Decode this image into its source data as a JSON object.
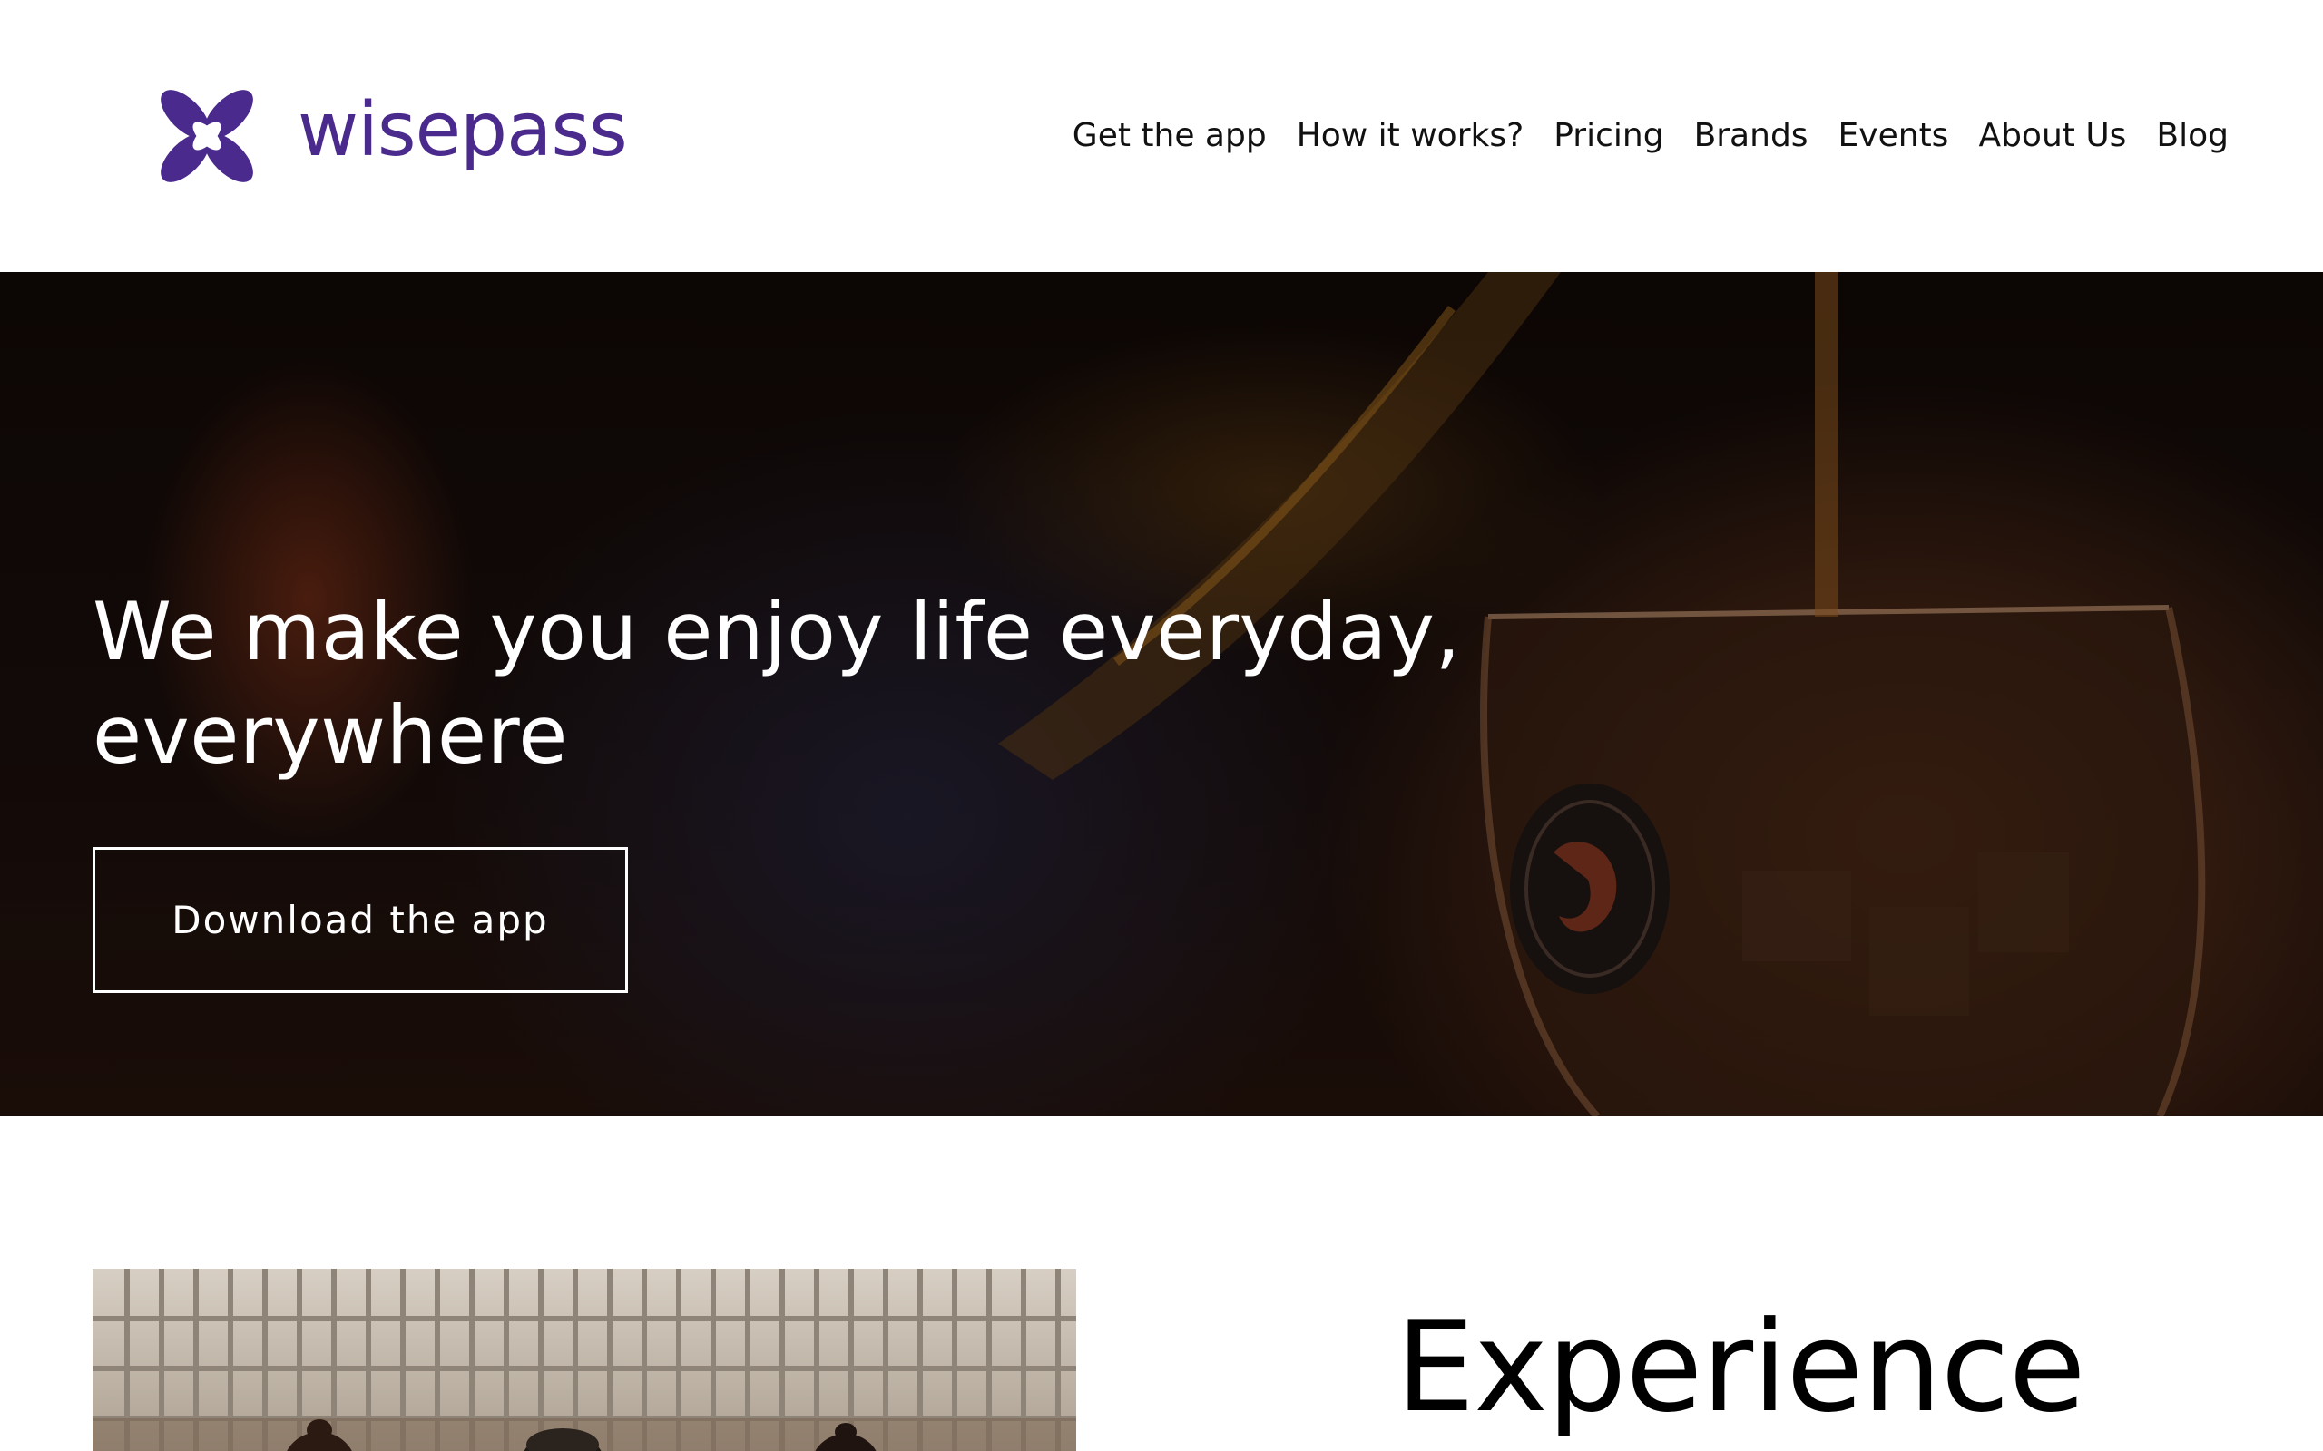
{
  "brand": {
    "name": "wisepass",
    "color": "#4a2a8c",
    "logo_icon": "wisepass-logo-icon"
  },
  "nav": {
    "items": [
      {
        "label": "Get the app"
      },
      {
        "label": "How it works?"
      },
      {
        "label": "Pricing"
      },
      {
        "label": "Brands"
      },
      {
        "label": "Events"
      },
      {
        "label": "About Us"
      },
      {
        "label": "Blog"
      }
    ]
  },
  "hero": {
    "heading": "We make you enjoy life everyday, everywhere",
    "cta_label": "Download the app",
    "text_color": "#ffffff"
  },
  "experience": {
    "title": "Experience"
  }
}
